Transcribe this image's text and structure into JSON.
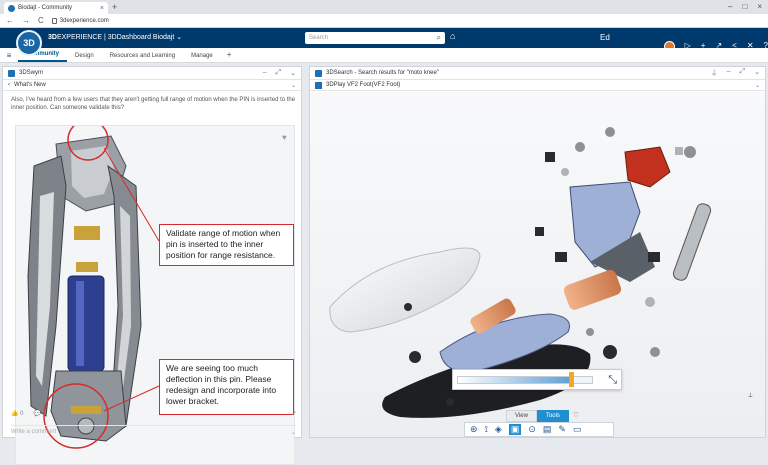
{
  "browser": {
    "tab_title": "Biodajt - Community",
    "url": "3dexperience.com",
    "nav": {
      "back": "←",
      "forward": "→",
      "reload": "C"
    }
  },
  "topbar": {
    "logo_text": "3D",
    "brand_bold": "3D",
    "brand_rest": "EXPERIENCE | 3DDashboard  Biodajt",
    "brand_caret": "⌄",
    "search_placeholder": "Search",
    "role": "Ed ENGINEER",
    "icons": [
      "tag-icon",
      "user-avatar",
      "share-arrow-icon",
      "plus-icon",
      "share-icon",
      "network-icon",
      "tools-icon",
      "help-icon"
    ]
  },
  "dashboard_tabs": {
    "items": [
      {
        "label": "Community",
        "active": true
      },
      {
        "label": "Design",
        "active": false
      },
      {
        "label": "Resources and Learning",
        "active": false
      },
      {
        "label": "Manage",
        "active": false
      }
    ],
    "add": "+"
  },
  "left_panel": {
    "app_title": "3DSwym",
    "subheader": "What's New",
    "post_text": "Also, I've heard from a few users that they aren't getting full range of motion when the PIN is inserted to the inner position. Can someone validate this?",
    "callout_1": "Validate range of motion when pin is inserted to the inner position for range resistance.",
    "callout_2": "We are seeing too much deflection in this pin. Please redesign and incorporate into lower bracket.",
    "likes": "0",
    "comments": "0",
    "comment_placeholder": "Write a comment"
  },
  "right_panel": {
    "app_title": "3DSearch - Search results for \"moto knee\"",
    "play_title": "3DPlay   VF2 Foot(VF2 Foot)",
    "slider_value": 0.85,
    "view_tabs": [
      {
        "label": "View",
        "active": false
      },
      {
        "label": "Tools",
        "active": true
      }
    ]
  },
  "colors": {
    "topbar": "#00396b",
    "accent": "#005686",
    "callout_border": "#d62b2b",
    "orange": "#e0752f"
  }
}
